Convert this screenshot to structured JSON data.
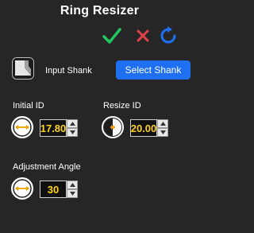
{
  "title": "Ring Resizer",
  "actions": {
    "accept_icon": "check-icon",
    "cancel_icon": "x-icon",
    "reset_icon": "refresh-icon"
  },
  "input_shank": {
    "label": "Input Shank",
    "button_label": "Select Shank"
  },
  "initial_id": {
    "label": "Initial ID",
    "value": "17.80"
  },
  "resize_id": {
    "label": "Resize ID",
    "value": "20.00"
  },
  "adjustment_angle": {
    "label": "Adjustment Angle",
    "value": "30"
  },
  "colors": {
    "background": "#262626",
    "accent_blue": "#1f6ff2",
    "value_yellow": "#ffd21a",
    "check_green": "#22c55e",
    "cancel_red": "#e0414a"
  }
}
